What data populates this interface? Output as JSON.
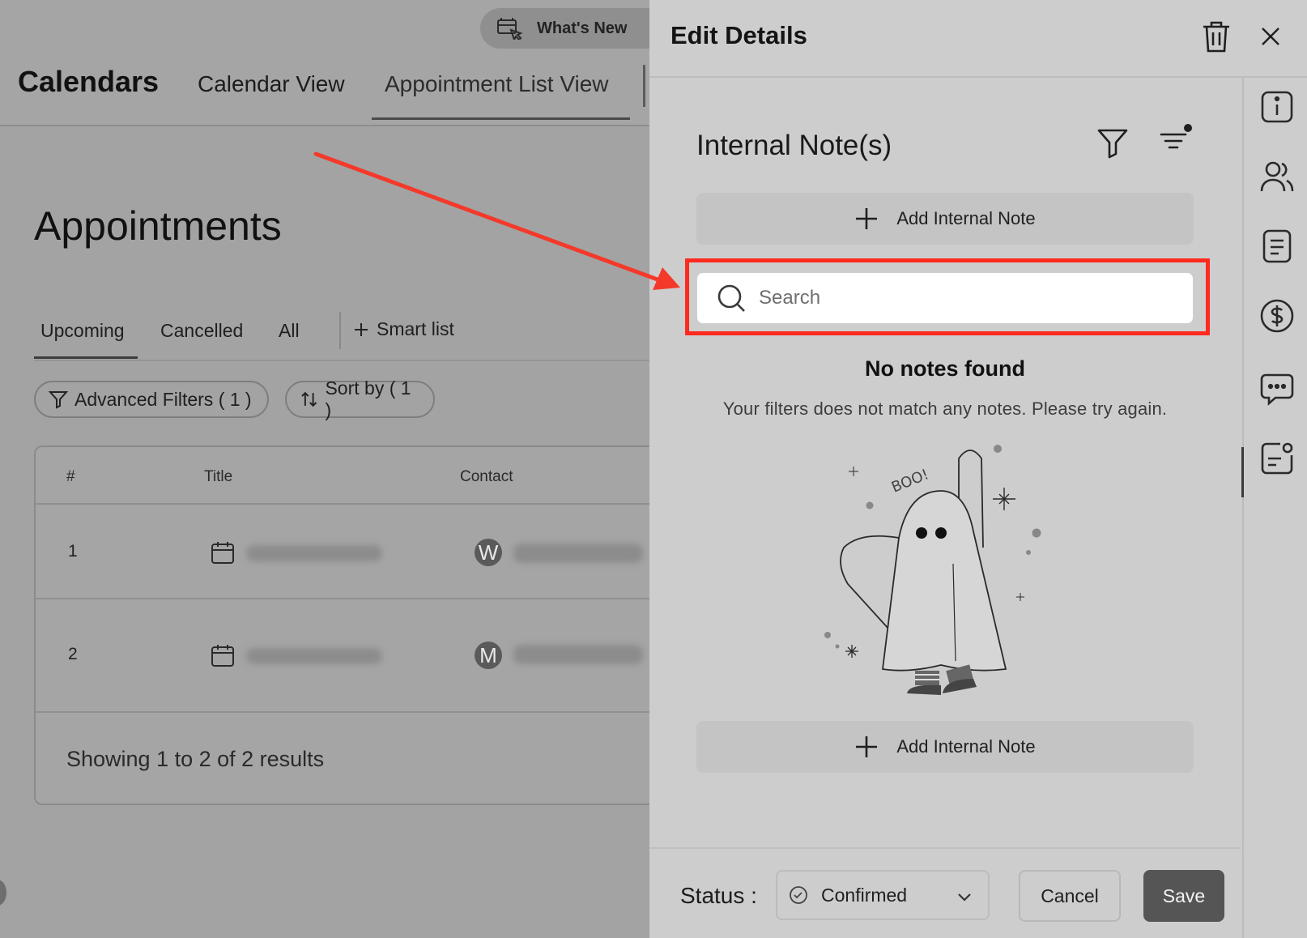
{
  "header": {
    "whats_new": "What's New",
    "app_title": "Calendars",
    "tabs": [
      "Calendar View",
      "Appointment List View"
    ]
  },
  "page": {
    "heading": "Appointments",
    "list_tabs": [
      "Upcoming",
      "Cancelled",
      "All"
    ],
    "smart_list": "Smart list",
    "advanced_filters": "Advanced Filters ( 1 )",
    "sort_by": "Sort by ( 1 )"
  },
  "table": {
    "columns": [
      "#",
      "Title",
      "Contact"
    ],
    "rows": [
      {
        "num": "1",
        "avatar": "W"
      },
      {
        "num": "2",
        "avatar": "M"
      }
    ],
    "summary": "Showing 1 to 2 of 2 results"
  },
  "drawer": {
    "title": "Edit Details",
    "section_title": "Internal Note(s)",
    "add_note_label": "Add Internal Note",
    "search": {
      "placeholder": "Search",
      "value": ""
    },
    "empty_title": "No notes found",
    "empty_subtitle": "Your filters does not match any notes. Please try again.",
    "illustration_text": "BOO!",
    "footer": {
      "status_label": "Status :",
      "status_value": "Confirmed",
      "cancel": "Cancel",
      "save": "Save"
    },
    "rail_icons": [
      "info-icon",
      "users-icon",
      "document-icon",
      "dollar-icon",
      "chat-icon",
      "notes-icon"
    ]
  },
  "colors": {
    "highlight": "#ff2a1f",
    "arrow": "#f4392a",
    "save_button": "#555555"
  }
}
